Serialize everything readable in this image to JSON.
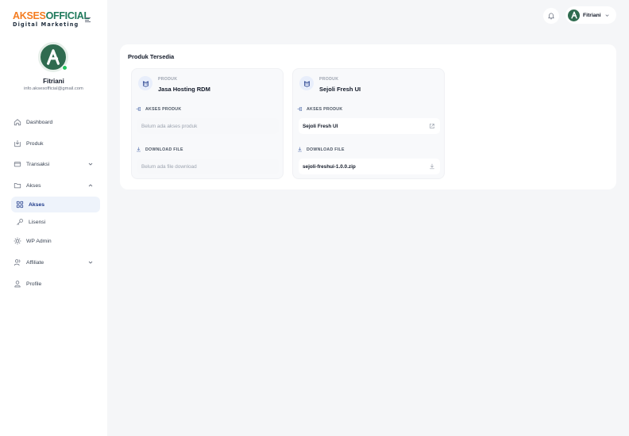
{
  "brand": {
    "name_part1": "AKSES",
    "name_part2": "OFFICIAL",
    "tagline": "Digital Marketing"
  },
  "user": {
    "name": "Fitriani",
    "email": "info.aksesofficial@gmail.com"
  },
  "sidebar": {
    "items": [
      {
        "label": "Dashboard",
        "icon": "home-icon"
      },
      {
        "label": "Produk",
        "icon": "box-icon"
      },
      {
        "label": "Transaksi",
        "icon": "card-icon",
        "expandable": true
      },
      {
        "label": "Akses",
        "icon": "folder-icon",
        "expandable": true,
        "expanded": true
      },
      {
        "label": "Akses",
        "icon": "grid-icon",
        "active": true
      },
      {
        "label": "Lisensi",
        "icon": "key-icon"
      },
      {
        "label": "WP Admin",
        "icon": "wordpress-icon"
      },
      {
        "label": "Affiliate",
        "icon": "users-icon",
        "expandable": true
      },
      {
        "label": "Profile",
        "icon": "user-icon"
      }
    ]
  },
  "header": {
    "user_name": "Fitriani"
  },
  "main": {
    "title": "Produk Tersedia",
    "cards": [
      {
        "kicker": "PRODUK",
        "name": "Jasa Hosting RDM",
        "access_label": "AKSES PRODUK",
        "access_value": "Belum ada akses produk",
        "download_label": "DOWNLOAD FILE",
        "download_value": "Belum ada file download"
      },
      {
        "kicker": "PRODUK",
        "name": "Sejoli Fresh UI",
        "access_label": "AKSES PRODUK",
        "access_value": "Sejoli Fresh UI",
        "download_label": "DOWNLOAD FILE",
        "download_value": "sejoli-freshui-1.0.0.zip"
      }
    ]
  },
  "colors": {
    "accent": "#1e3a8a",
    "brand_orange": "#f47c20",
    "brand_green": "#1f7a5c",
    "online": "#22c55e"
  }
}
